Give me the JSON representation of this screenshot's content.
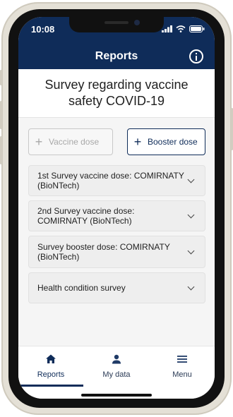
{
  "status_bar": {
    "time": "10:08"
  },
  "header": {
    "title": "Reports"
  },
  "survey": {
    "title": "Survey regarding vaccine safety COVID-19"
  },
  "buttons": {
    "vaccine_dose": {
      "label": "Vaccine dose",
      "enabled": false
    },
    "booster_dose": {
      "label": "Booster dose",
      "enabled": true
    }
  },
  "surveys": [
    {
      "label": "1st Survey vaccine dose: COMIRNATY (BioNTech)"
    },
    {
      "label": "2nd Survey vaccine dose: COMIRNATY (BioNTech)"
    },
    {
      "label": "Survey booster dose: COMIRNATY (BioNTech)"
    },
    {
      "label": "Health condition survey"
    }
  ],
  "tabs": [
    {
      "label": "Reports",
      "icon": "home-icon",
      "active": true
    },
    {
      "label": "My data",
      "icon": "person-icon",
      "active": false
    },
    {
      "label": "Menu",
      "icon": "menu-icon",
      "active": false
    }
  ],
  "colors": {
    "accent": "#0f2c59",
    "background": "#f5f5f5",
    "card": "#eeeeee"
  }
}
